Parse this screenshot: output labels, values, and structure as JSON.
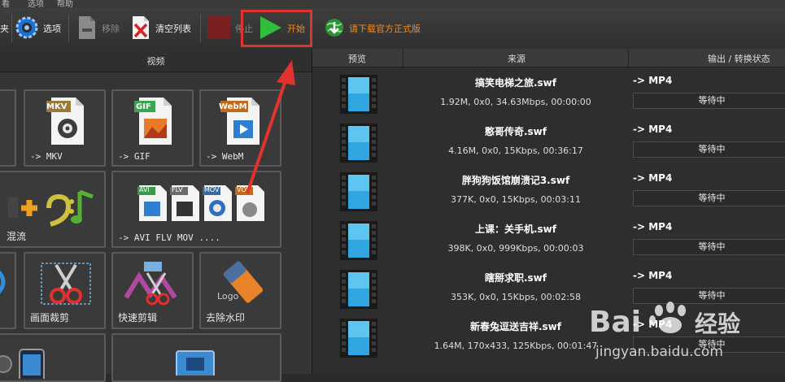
{
  "menubar": {
    "items": [
      "看",
      "选项",
      "帮助"
    ]
  },
  "toolbar": {
    "folder_label": "夹",
    "options_label": "选项",
    "remove_label": "移除",
    "clear_label": "清空列表",
    "stop_label": "停止",
    "start_label": "开始",
    "download_label": "请下载官方正式版"
  },
  "left_panel": {
    "header": "视频",
    "tiles": [
      {
        "label": "-> MKV",
        "badge": "MKV"
      },
      {
        "label": "-> GIF",
        "badge": "GIF"
      },
      {
        "label": "-> WebM",
        "badge": "WebM"
      },
      {
        "label": "混流"
      },
      {
        "label": "-> AVI FLV MOV ....",
        "badges": [
          "AVI",
          "FLV",
          "MOV",
          "VOB"
        ]
      },
      {
        "label": "画面裁剪"
      },
      {
        "label": "快速剪辑"
      },
      {
        "label": "去除水印",
        "badge": "Logo"
      }
    ]
  },
  "right_panel": {
    "columns": [
      "预览",
      "来源",
      "输出 / 转换状态"
    ],
    "rows": [
      {
        "name": "搞笑电梯之旅.swf",
        "info": "1.92M, 0x0, 34.63Mbps, 00:00:00",
        "format": "-> MP4",
        "status": "等待中"
      },
      {
        "name": "憨哥传奇.swf",
        "info": "4.16M, 0x0, 15Kbps, 00:36:17",
        "format": "-> MP4",
        "status": "等待中"
      },
      {
        "name": "胖狗狗饭馆崩溃记3.swf",
        "info": "377K, 0x0, 15Kbps, 00:03:11",
        "format": "-> MP4",
        "status": "等待中"
      },
      {
        "name": "上课：关手机.swf",
        "info": "398K, 0x0, 999Kbps, 00:00:03",
        "format": "-> MP4",
        "status": "等待中"
      },
      {
        "name": "瞎掰求职.swf",
        "info": "353K, 0x0, 15Kbps, 00:02:58",
        "format": "-> MP4",
        "status": "等待中"
      },
      {
        "name": "新春兔逗送吉祥.swf",
        "info": "1.64M, 170x433, 125Kbps, 00:01:47",
        "format": "-> MP4",
        "status": "等待中"
      }
    ]
  },
  "watermark": {
    "text": "Bai",
    "text2": "经验",
    "url": "jingyan.baidu.com"
  },
  "colors": {
    "start_green": "#2fbf3a",
    "highlight_red": "#e0322e",
    "download_orange": "#f08a24"
  }
}
